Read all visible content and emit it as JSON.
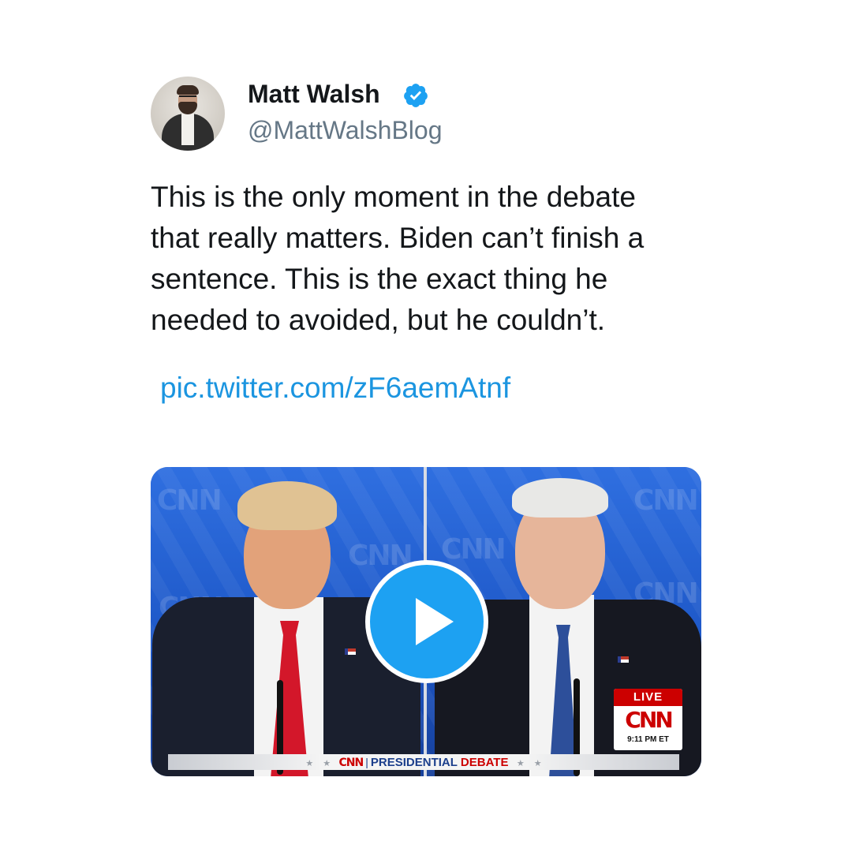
{
  "author": {
    "name": "Matt Walsh",
    "handle": "@MattWalshBlog",
    "verified_icon": "verified-badge-icon",
    "verified_color": "#1da1f2"
  },
  "tweet": {
    "lines": [
      "This is the only moment in the debate",
      "that really matters. Biden can’t finish a",
      "sentence. This is the exact thing he",
      "needed to avoided, but he couldn’t."
    ],
    "link": "pic.twitter.com/zF6aemAtnf",
    "link_color": "#1b95e0"
  },
  "video": {
    "play_icon": "play-icon",
    "play_color": "#1da1f2",
    "live_label": "LIVE",
    "live_network": "CNN",
    "live_time": "9:11 PM ET",
    "banner_network": "CNN",
    "banner_separator": "|",
    "banner_title": "PRESIDENTIAL",
    "banner_subtitle": "DEBATE",
    "background_logo": "CNN"
  }
}
